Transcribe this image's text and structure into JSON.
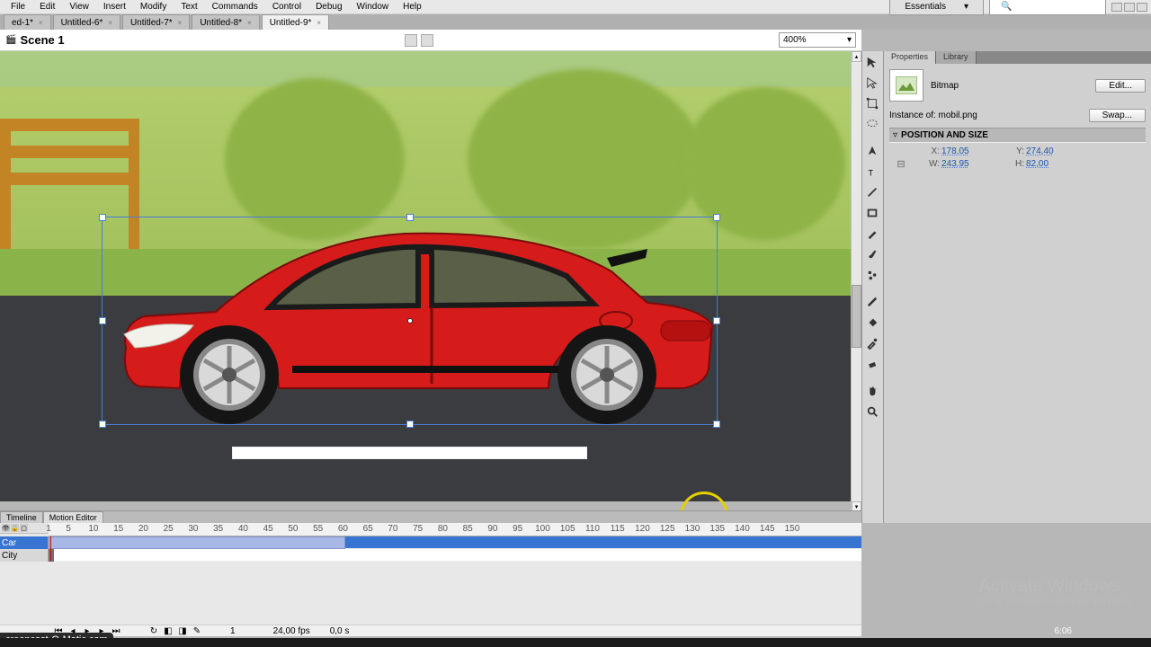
{
  "menu": {
    "items": [
      "File",
      "Edit",
      "View",
      "Insert",
      "Modify",
      "Text",
      "Commands",
      "Control",
      "Debug",
      "Window",
      "Help"
    ]
  },
  "workspace": "Essentials",
  "tabs": [
    "ed-1*",
    "Untitled-6*",
    "Untitled-7*",
    "Untitled-8*",
    "Untitled-9*"
  ],
  "activeTab": 4,
  "scene": "Scene 1",
  "zoom": "400%",
  "panel": {
    "tabs": [
      "Properties",
      "Library"
    ],
    "type": "Bitmap",
    "editBtn": "Edit...",
    "swapBtn": "Swap...",
    "instanceLabel": "Instance of:",
    "instanceName": "mobil.png",
    "section": "POSITION AND SIZE",
    "x": "178,05",
    "y": "274,40",
    "w": "243,95",
    "h": "82,00",
    "xl": "X:",
    "yl": "Y:",
    "wl": "W:",
    "hl": "H:"
  },
  "timeline": {
    "tabs": [
      "Timeline",
      "Motion Editor"
    ],
    "layers": [
      "Car",
      "City"
    ],
    "rulerMarks": [
      1,
      5,
      10,
      15,
      20,
      25,
      30,
      35,
      40,
      45,
      50,
      55,
      60,
      65,
      70,
      75,
      80,
      85,
      90,
      95,
      100,
      105,
      110,
      115,
      120,
      125,
      130,
      135,
      140,
      145,
      150
    ],
    "fps": "24,00 fps",
    "elapsed": "0,0 s",
    "frame": "1"
  },
  "activate": {
    "t1": "Activate Windows",
    "t2": "Go to Settings to activate Windows."
  },
  "screencast": "creencast-O-Matic.com",
  "clock": "6:06"
}
